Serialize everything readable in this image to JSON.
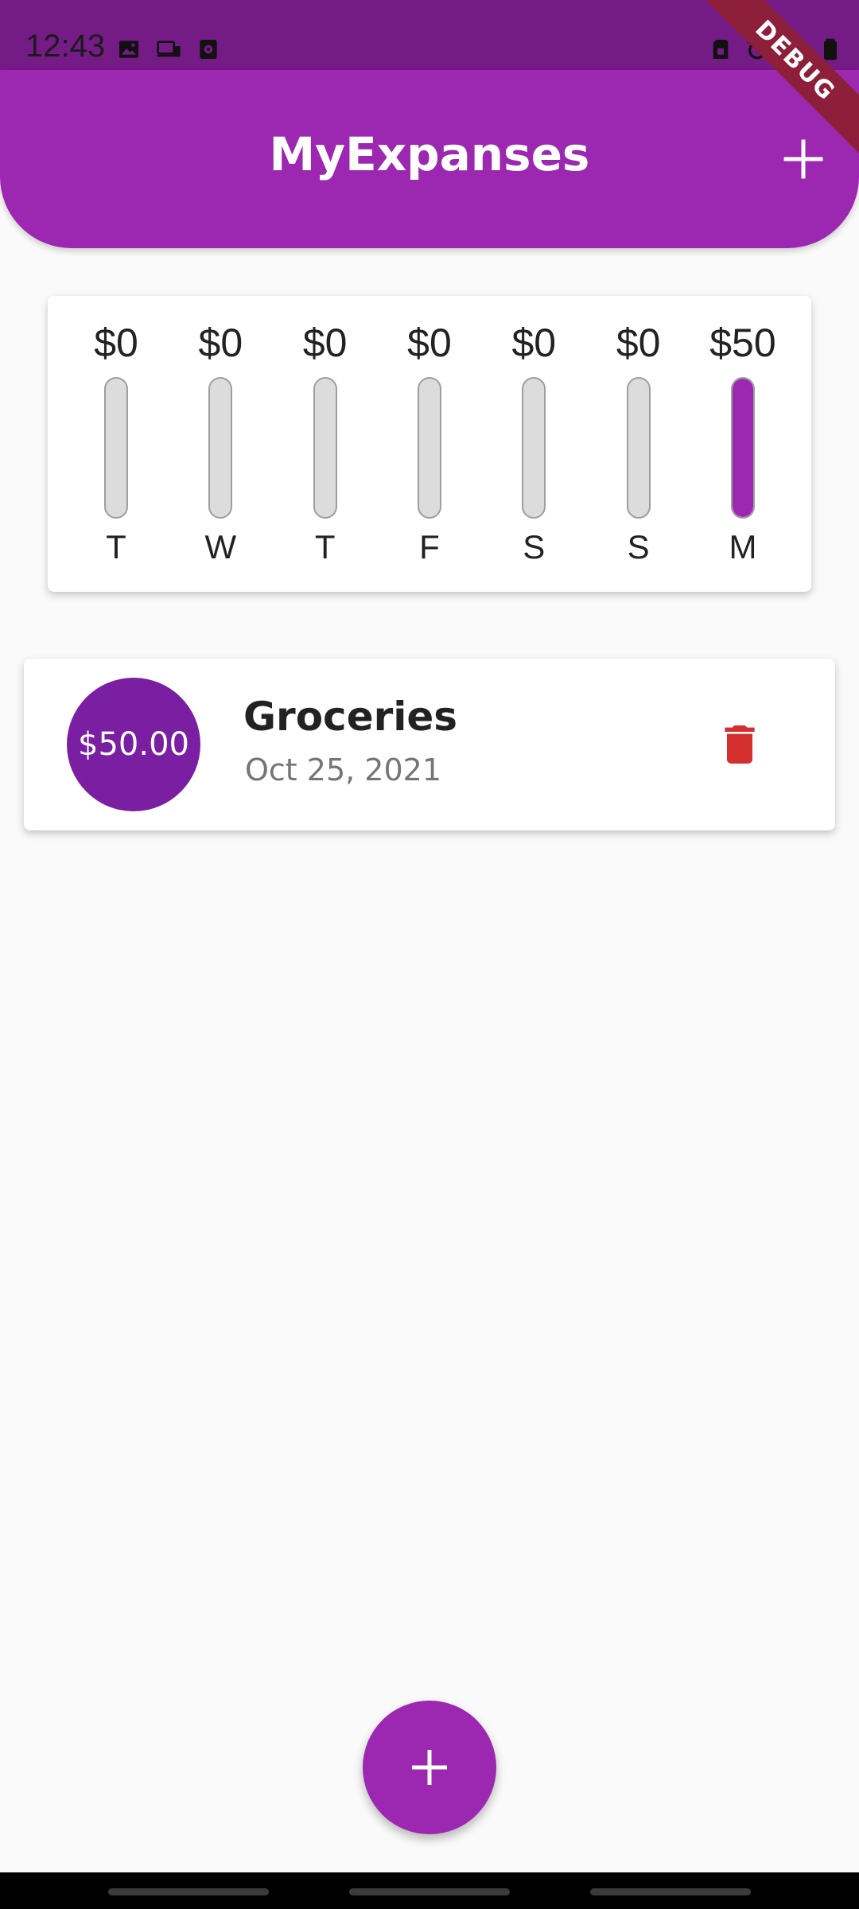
{
  "status_bar": {
    "time": "12:43",
    "network": "4G"
  },
  "debug_banner": {
    "label": "DEBUG"
  },
  "app_bar": {
    "title": "MyExpanses",
    "add_icon": "plus-icon"
  },
  "colors": {
    "primary": "#9c27b0",
    "primary_dark": "#7b1fa2",
    "status_bar": "#751b86",
    "delete": "#d32f2f",
    "background": "#fafafa"
  },
  "chart_data": {
    "type": "bar",
    "categories": [
      "T",
      "W",
      "T",
      "F",
      "S",
      "S",
      "M"
    ],
    "values": [
      0,
      0,
      0,
      0,
      0,
      0,
      50
    ],
    "value_labels": [
      "$0",
      "$0",
      "$0",
      "$0",
      "$0",
      "$0",
      "$50"
    ],
    "title": "",
    "xlabel": "",
    "ylabel": "",
    "ylim": [
      0,
      50
    ]
  },
  "transactions": [
    {
      "amount": "$50.00",
      "title": "Groceries",
      "date": "Oct 25, 2021",
      "delete_icon": "trash-icon"
    }
  ],
  "fab": {
    "icon": "plus-icon"
  }
}
